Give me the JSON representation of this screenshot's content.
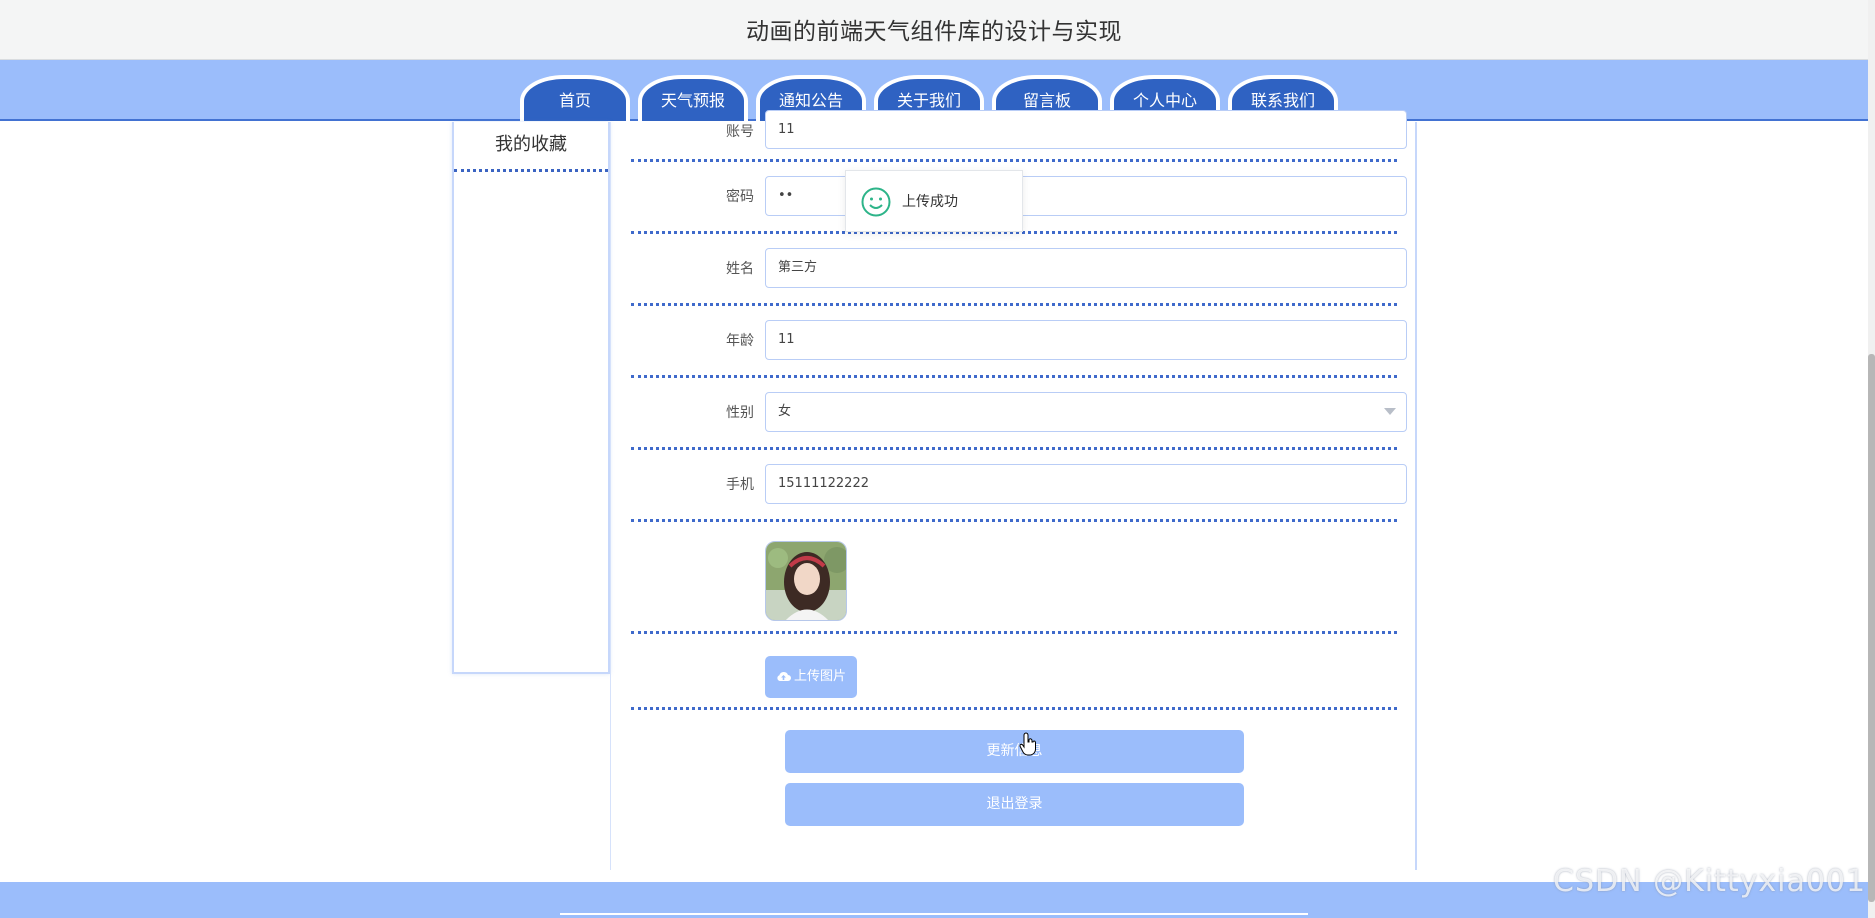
{
  "site_title": "动画的前端天气组件库的设计与实现",
  "nav": [
    "首页",
    "天气预报",
    "通知公告",
    "关于我们",
    "留言板",
    "个人中心",
    "联系我们"
  ],
  "sidebar": {
    "items": [
      "我的收藏"
    ]
  },
  "form": {
    "account_label": "账号",
    "account_value": "11",
    "password_label": "密码",
    "password_value": "••",
    "name_label": "姓名",
    "name_value": "第三方",
    "age_label": "年龄",
    "age_value": "11",
    "gender_label": "性别",
    "gender_value": "女",
    "phone_label": "手机",
    "phone_value": "15111122222",
    "upload_label": "上传图片",
    "update_label": "更新信息",
    "logout_label": "退出登录"
  },
  "toast": {
    "message": "上传成功"
  },
  "watermark": "CSDN @Kittyxia001",
  "colors": {
    "nav_bg": "#9bbdfb",
    "tab_bg": "#2f62c2",
    "button_bg": "#9bbdfb",
    "divider": "#3f6acb",
    "success": "#2db489"
  },
  "icons": [
    "smile-icon",
    "cloud-upload-icon",
    "hand-cursor-icon"
  ]
}
